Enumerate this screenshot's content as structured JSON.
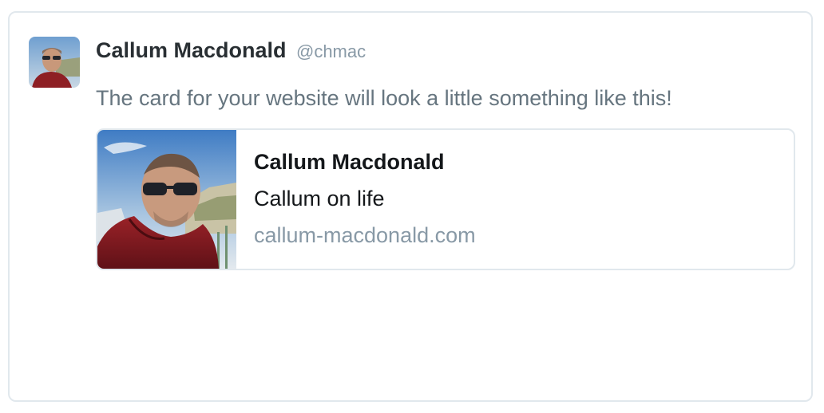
{
  "tweet": {
    "display_name": "Callum Macdonald",
    "handle": "@chmac",
    "text": "The card for your website will look a little something like this!",
    "avatar_icon": "user-photo-avatar"
  },
  "card": {
    "title": "Callum Macdonald",
    "description": "Callum on life",
    "domain": "callum-macdonald.com",
    "image_icon": "selfie-photo-thumbnail"
  },
  "colors": {
    "border": "#e1e8ed",
    "name": "#292f33",
    "tweet_text": "#66757f",
    "muted": "#8899a6",
    "card_text": "#14171a"
  }
}
